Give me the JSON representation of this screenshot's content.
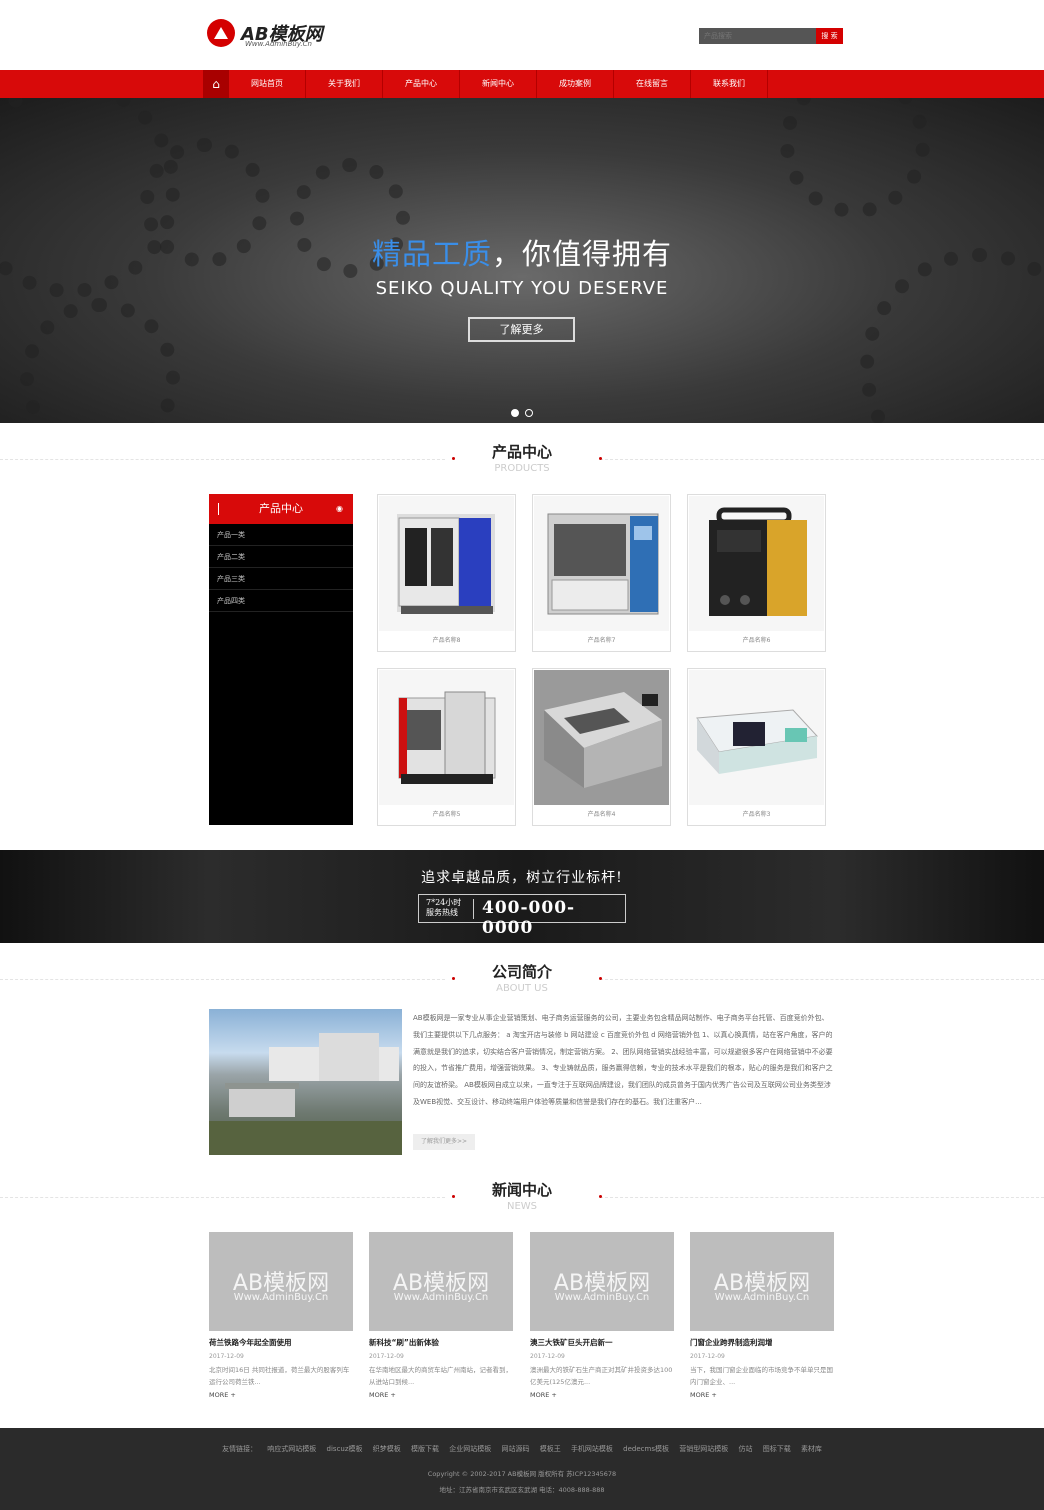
{
  "header": {
    "logo_name": "AB模板网",
    "logo_url": "Www.AdminBuy.Cn",
    "search_placeholder": "产品搜索",
    "search_button": "搜 索"
  },
  "nav": {
    "home_icon": "home-icon",
    "items": [
      "网站首页",
      "关于我们",
      "产品中心",
      "新闻中心",
      "成功案例",
      "在线留言",
      "联系我们"
    ]
  },
  "hero": {
    "title_highlight": "精品工质",
    "title_rest": "，你值得拥有",
    "subtitle": "SEIKO QUALITY YOU DESERVE",
    "button": "了解更多",
    "active_slide": 1,
    "slide_count": 2
  },
  "products": {
    "title": "产品中心",
    "title_en": "PRODUCTS",
    "sidebar_title": "产品中心",
    "categories": [
      "产品一类",
      "产品二类",
      "产品三类",
      "产品四类"
    ],
    "items": [
      "产品名称8",
      "产品名称7",
      "产品名称6",
      "产品名称5",
      "产品名称4",
      "产品名称3"
    ]
  },
  "banner": {
    "slogan": "追求卓越品质，树立行业标杆!",
    "hotline_label_1": "7*24小时",
    "hotline_label_2": "服务热线",
    "phone": "400-000-0000"
  },
  "about": {
    "title": "公司简介",
    "title_en": "ABOUT US",
    "text": "AB模板网是一家专业从事企业营销策划、电子商务运营服务的公司，主要业务包含精品网站制作、电子商务平台托管、百度竞价外包、 我们主要提供以下几点服务： a 淘宝开店与装修 b 网站建设 c 百度竞价外包 d 网络营销外包 1、以真心换真情，站在客户角度，客户的满意就是我们的追求，切实结合客户营销情况，制定营销方案。 2、团队网络营销实战经验丰富，可以规避很多客户在网络营销中不必要的投入，节省推广费用，增强营销效果。 3、专业铸就品质，服务赢得信赖，专业的技术水平是我们的根本，贴心的服务是我们和客户之间的友谊桥梁。 AB模板网自成立以来，一直专注于互联网品牌建设，我们团队的成员曾务于国内优秀广告公司及互联网公司业务类型涉及WEB视觉、交互设计、移动终端用户体验等质量和信誉是我们存在的基石。我们注重客户...",
    "more": "了解我们更多>>"
  },
  "news": {
    "title": "新闻中心",
    "title_en": "NEWS",
    "watermark_1": "AB模板网",
    "watermark_2": "Www.AdminBuy.Cn",
    "items": [
      {
        "title": "荷兰铁路今年起全面使用",
        "date": "2017-12-09",
        "desc": "北京时间16日 共同社报道，荷兰最大的股客列车运行公司荷兰铁...",
        "more": "MORE +"
      },
      {
        "title": "新科技“刷”出新体验",
        "date": "2017-12-09",
        "desc": "在华南地区最大的商贸车站广州南站，记者看到，从进站口到候...",
        "more": "MORE +"
      },
      {
        "title": "澳三大铁矿巨头开启新一",
        "date": "2017-12-09",
        "desc": "澳洲最大的铁矿石生产商正对其矿井投资多达100亿美元(125亿澳元...",
        "more": "MORE +"
      },
      {
        "title": "门窗企业跨界制造利润增",
        "date": "2017-12-09",
        "desc": "当下，我国门窗企业面临的市场竞争不单单只是国内门窗企业、...",
        "more": "MORE +"
      }
    ]
  },
  "footer": {
    "links_label": "友情链接：",
    "links": [
      "响应式网站模板",
      "discuz模板",
      "织梦模板",
      "模版下载",
      "企业网站模板",
      "网站源码",
      "模板王",
      "手机网站模板",
      "dedecms模板",
      "营销型网站模板",
      "仿站",
      "图标下载",
      "素材库"
    ],
    "copyright": "Copyright © 2002-2017 AB模板网 版权所有 苏ICP12345678",
    "address": "地址：江苏省南京市玄武区玄武湖 电话：4008-888-888"
  }
}
